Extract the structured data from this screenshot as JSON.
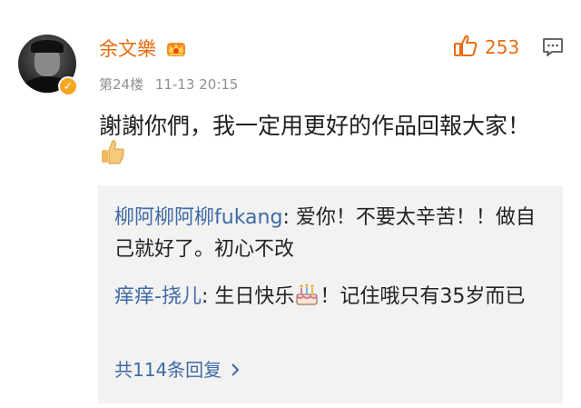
{
  "post": {
    "username": "余文樂",
    "floor": "第24楼",
    "datetime": "11-13 20:15",
    "like_count": "253",
    "content": "謝謝你們，我一定用更好的作品回報大家！",
    "verified_badge_icon": "v-badge-icon",
    "member_icon": "crown-icon"
  },
  "replies": [
    {
      "name": "柳阿柳阿柳fukang",
      "text": ": 爱你！不要太辛苦！！做自己就好了。初心不改"
    },
    {
      "name": "痒痒-挠儿",
      "text_before": ": 生日快乐",
      "emoji": "birthday-cake-icon",
      "text_after": "！记住哦只有35岁而已"
    }
  ],
  "more_replies": "共114条回复",
  "colors": {
    "accent": "#e86b0e",
    "link": "#3f6aa6",
    "reply_bg": "#f2f2f2",
    "meta": "#8f8f8f"
  }
}
